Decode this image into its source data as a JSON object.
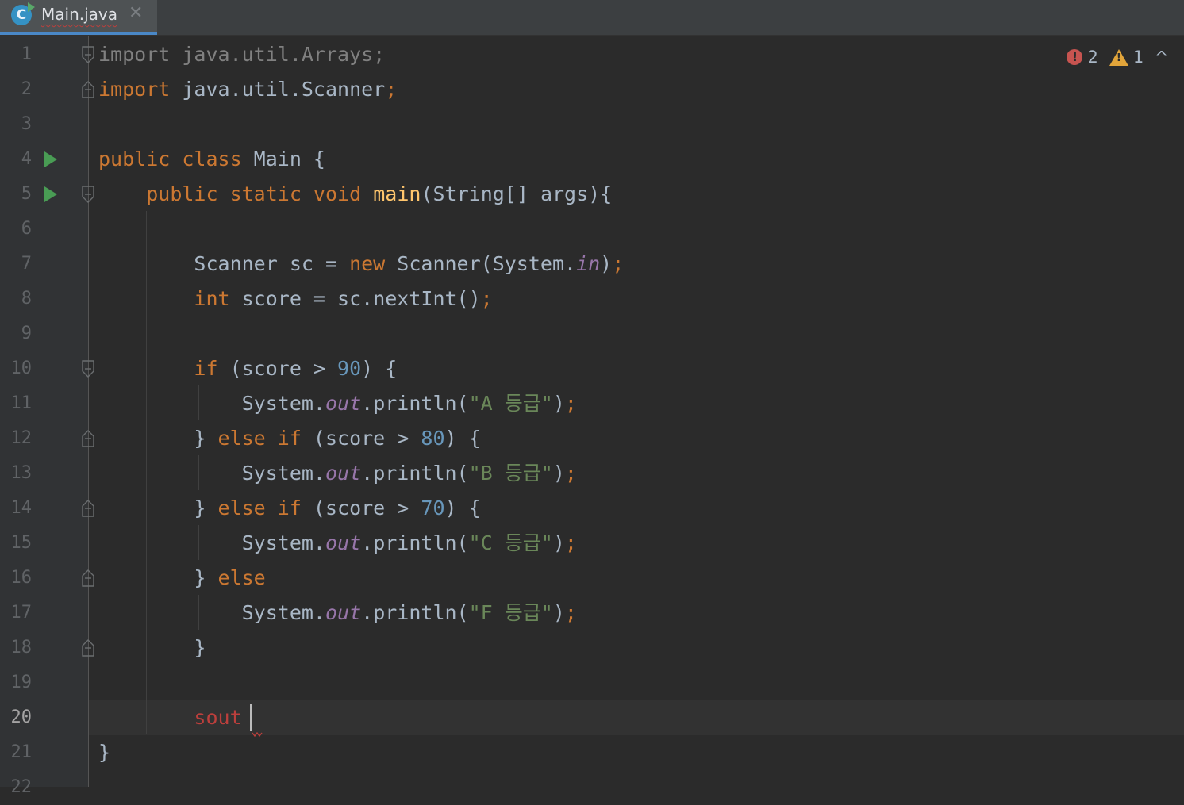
{
  "tab": {
    "file_name": "Main.java",
    "icon_letter": "C",
    "close_glyph": "✕"
  },
  "inspections": {
    "errors": "2",
    "warnings": "1",
    "error_glyph": "!",
    "warning_glyph": "!",
    "collapse_glyph": "^"
  },
  "editor": {
    "current_line": 20,
    "lines": [
      {
        "n": "1",
        "html": "<span class=\"dim\">import java.util.Arrays;</span>"
      },
      {
        "n": "2",
        "html": "<span class=\"kw\">import</span> java.util.Scanner<span class=\"kw\">;</span>"
      },
      {
        "n": "3",
        "html": ""
      },
      {
        "n": "4",
        "html": "<span class=\"kw\">public class</span> Main {"
      },
      {
        "n": "5",
        "html": "    <span class=\"kw\">public static void</span> <span class=\"fn\">main</span>(String[] args){"
      },
      {
        "n": "6",
        "html": ""
      },
      {
        "n": "7",
        "html": "        Scanner sc = <span class=\"kw\">new</span> Scanner(System.<span class=\"stat\">in</span>)<span class=\"kw\">;</span>"
      },
      {
        "n": "8",
        "html": "        <span class=\"kw\">int</span> score = sc.nextInt()<span class=\"kw\">;</span>"
      },
      {
        "n": "9",
        "html": ""
      },
      {
        "n": "10",
        "html": "        <span class=\"kw\">if</span> (score &gt; <span class=\"num\">90</span>) {"
      },
      {
        "n": "11",
        "html": "            System.<span class=\"stat\">out</span>.println(<span class=\"str\">\"A 등급\"</span>)<span class=\"kw\">;</span>"
      },
      {
        "n": "12",
        "html": "        } <span class=\"kw\">else if</span> (score &gt; <span class=\"num\">80</span>) {"
      },
      {
        "n": "13",
        "html": "            System.<span class=\"stat\">out</span>.println(<span class=\"str\">\"B 등급\"</span>)<span class=\"kw\">;</span>"
      },
      {
        "n": "14",
        "html": "        } <span class=\"kw\">else if</span> (score &gt; <span class=\"num\">70</span>) {"
      },
      {
        "n": "15",
        "html": "            System.<span class=\"stat\">out</span>.println(<span class=\"str\">\"C 등급\"</span>)<span class=\"kw\">;</span>"
      },
      {
        "n": "16",
        "html": "        } <span class=\"kw\">else</span>"
      },
      {
        "n": "17",
        "html": "            System.<span class=\"stat\">out</span>.println(<span class=\"str\">\"F 등급\"</span>)<span class=\"kw\">;</span>"
      },
      {
        "n": "18",
        "html": "        }"
      },
      {
        "n": "19",
        "html": ""
      },
      {
        "n": "20",
        "html": "        <span class=\"err\">sout</span>"
      },
      {
        "n": "21",
        "html": "}"
      },
      {
        "n": "22",
        "html": ""
      }
    ]
  },
  "gutter": {
    "run_lines": [
      4,
      5
    ],
    "fold_open_lines": [
      1,
      5,
      10
    ],
    "fold_close_lines": [
      2,
      12,
      14,
      16,
      18
    ]
  },
  "colors": {
    "background": "#2b2b2b",
    "keyword": "#cc7832",
    "number": "#6897bb",
    "string": "#6a8759",
    "method": "#ffc66d",
    "static_field": "#9876aa",
    "error": "#bc3f3c",
    "default_text": "#a9b7c6"
  }
}
